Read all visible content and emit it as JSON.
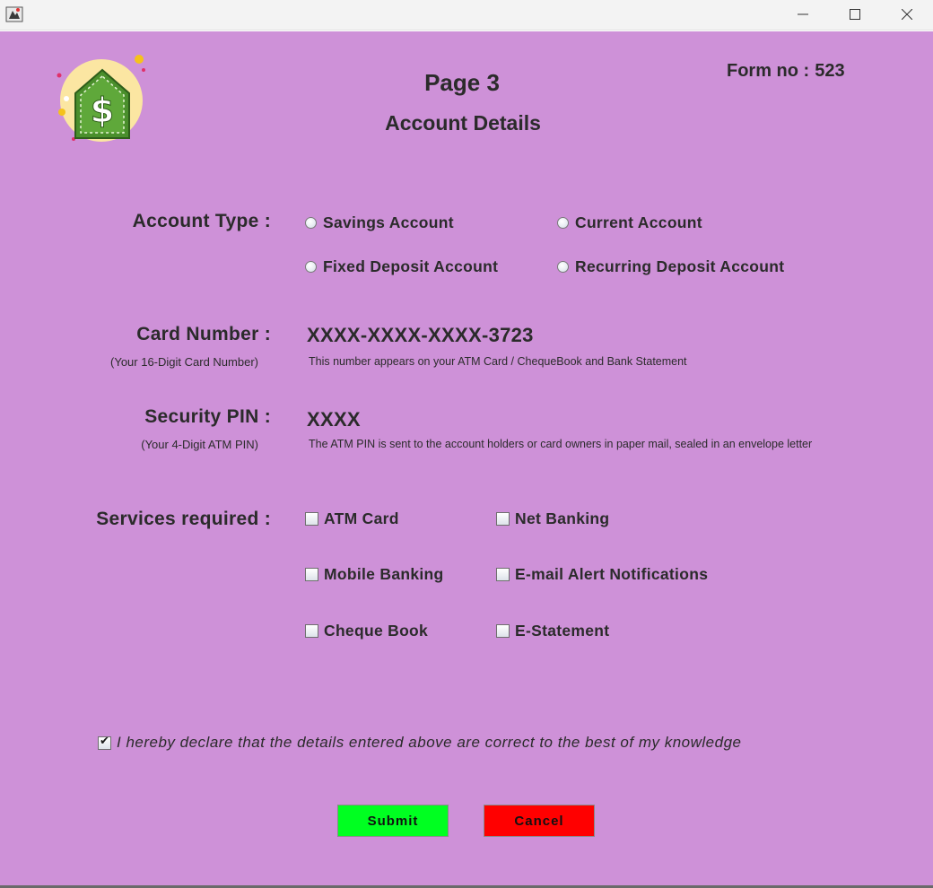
{
  "window": {
    "minimize_label": "minimize",
    "maximize_label": "maximize",
    "close_label": "close"
  },
  "header": {
    "page_title": "Page 3",
    "subtitle": "Account Details",
    "form_no_label": "Form no :",
    "form_no_value": "523"
  },
  "logo": {
    "icon": "dollar-house-icon"
  },
  "account_type": {
    "label": "Account Type :",
    "options": [
      {
        "label": "Savings Account",
        "selected": false
      },
      {
        "label": "Current Account",
        "selected": false
      },
      {
        "label": "Fixed Deposit Account",
        "selected": false
      },
      {
        "label": "Recurring Deposit Account",
        "selected": false
      }
    ]
  },
  "card": {
    "label": "Card Number :",
    "hint": "(Your 16-Digit Card Number)",
    "value": "XXXX-XXXX-XXXX-3723",
    "note": "This number appears on your ATM Card / ChequeBook and Bank Statement"
  },
  "pin": {
    "label": "Security PIN :",
    "hint": "(Your 4-Digit ATM PIN)",
    "value": "XXXX",
    "note": "The ATM PIN is sent to the account holders or card owners in paper mail, sealed in an envelope letter"
  },
  "services": {
    "label": "Services required :",
    "items": [
      {
        "label": "ATM Card",
        "checked": false
      },
      {
        "label": "Net Banking",
        "checked": false
      },
      {
        "label": "Mobile Banking",
        "checked": false
      },
      {
        "label": "E-mail Alert Notifications",
        "checked": false
      },
      {
        "label": "Cheque Book",
        "checked": false
      },
      {
        "label": "E-Statement",
        "checked": false
      }
    ]
  },
  "declaration": {
    "text": "I hereby declare that the details entered above are correct to the best of my knowledge",
    "checked": true
  },
  "buttons": {
    "submit": "Submit",
    "cancel": "Cancel"
  },
  "colors": {
    "background": "#ce91d8",
    "submit": "#00ff21",
    "cancel": "#ff0000",
    "text": "#2b2b2b"
  }
}
